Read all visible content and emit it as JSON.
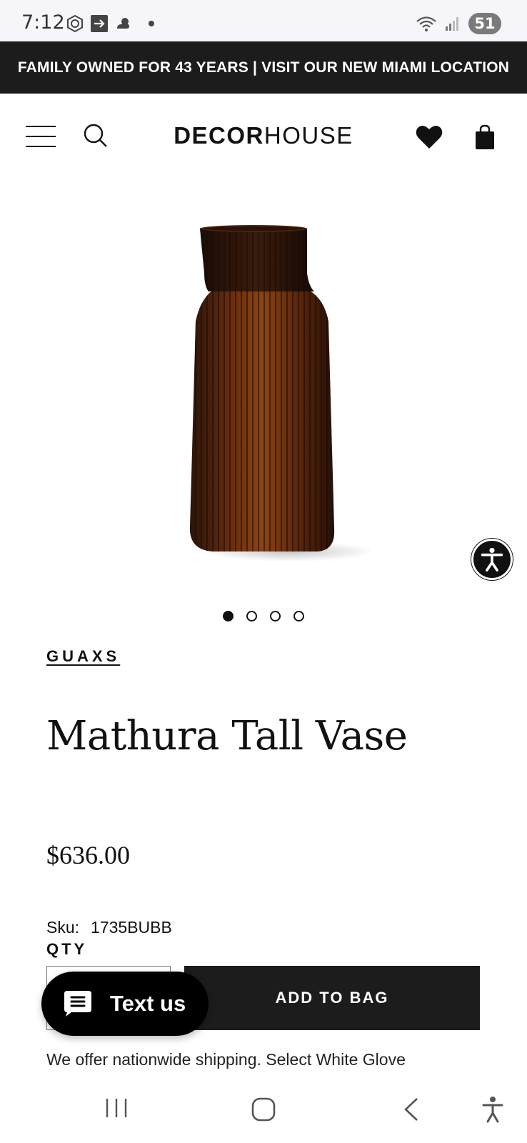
{
  "status_bar": {
    "time": "7:12",
    "battery": "51"
  },
  "announcement": "FAMILY OWNED FOR 43 YEARS | VISIT OUR NEW MIAMI LOCATION",
  "header": {
    "logo_bold": "DECOR",
    "logo_light": "HOUSE"
  },
  "product": {
    "brand": "GUAXS",
    "title": "Mathura Tall Vase",
    "price": "$636.00",
    "sku_label": "Sku:",
    "sku_value": "1735BUBB",
    "qty_label": "QTY",
    "add_to_bag": "ADD TO BAG",
    "shipping_note": "We offer nationwide shipping. Select White Glove",
    "image_count": 4,
    "active_image": 1
  },
  "chat_widget": {
    "label": "Text us"
  },
  "colors": {
    "announcement_bg": "#1c1c1c",
    "button_bg": "#1c1c1c",
    "vase_amber": "#7a3a10",
    "vase_dark": "#2a140a"
  }
}
